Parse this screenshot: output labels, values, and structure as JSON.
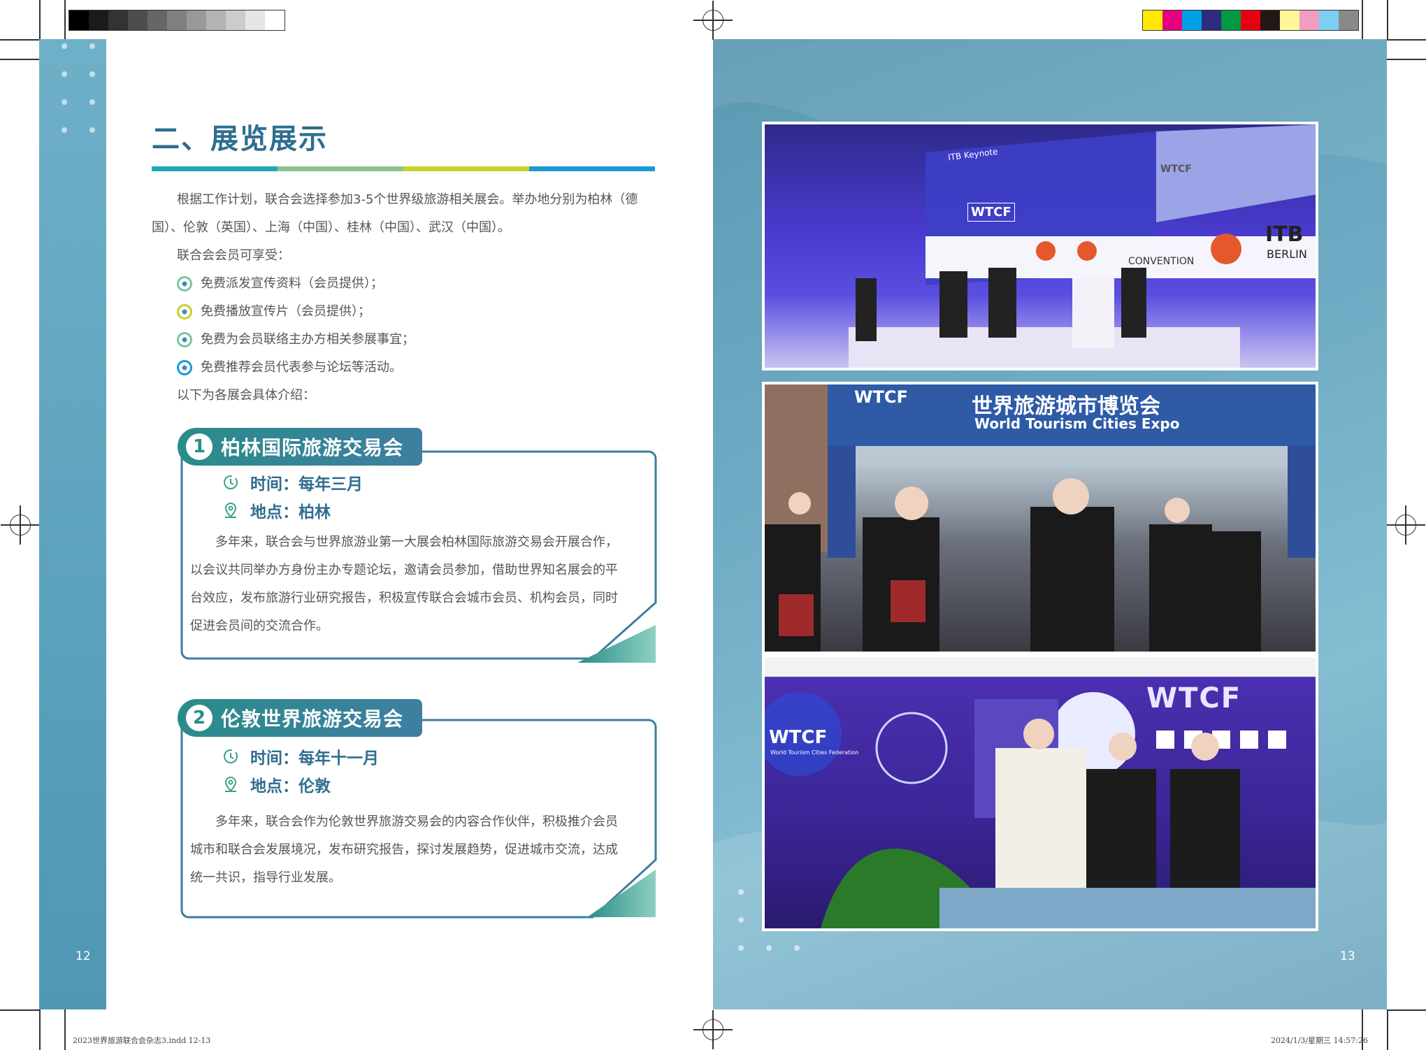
{
  "left_page": {
    "heading": "二、展览展示",
    "heading_bar_colors": [
      "#1ba8b8",
      "#8cc48c",
      "#c8d22a",
      "#1c9ad6"
    ],
    "intro_lines": [
      "根据工作计划，联合会选择参加3-5个世界级旅游相关展会。举办地分别为柏林（德",
      "国）、伦敦（英国）、上海（中国）、桂林（中国）、武汉（中国）。",
      "联合会会员可享受："
    ],
    "benefits": [
      "免费派发宣传资料（会员提供）；",
      "免费播放宣传片（会员提供）；",
      "免费为会员联络主办方相关参展事宜；",
      "免费推荐会员代表参与论坛等活动。"
    ],
    "intro_outro": "以下为各展会具体介绍：",
    "cards": [
      {
        "number": "1",
        "title": "柏林国际旅游交易会",
        "time": "时间：每年三月",
        "place": "地点：柏林",
        "lines": [
          "多年来，联合会与世界旅游业第一大展会柏林国际旅游交易会开展合作，",
          "以会议共同举办方身份主办专题论坛，邀请会员参加，借助世界知名展会的平",
          "台效应，发布旅游行业研究报告，积极宣传联合会城市会员、机构会员，同时",
          "促进会员间的交流合作。"
        ]
      },
      {
        "number": "2",
        "title": "伦敦世界旅游交易会",
        "time": "时间：每年十一月",
        "place": "地点：伦敦",
        "lines": [
          "多年来，联合会作为伦敦世界旅游交易会的内容合作伙伴，积极推介会员",
          "城市和联合会发展境况，发布研究报告，探讨发展趋势，促进城市交流，达成",
          "统一共识，指导行业发展。"
        ]
      }
    ],
    "page_number": "12",
    "file_note": "2023世界旅游联合会杂志3.indd   12-13"
  },
  "right_page": {
    "photo1": {
      "screen_text_keynote": "ITB Keynote",
      "logo_wtcf": "WTCF",
      "itb_logo": "ITB",
      "itb_city": "BERLIN",
      "convention": "CONVENTION"
    },
    "photo2": {
      "banner_cn": "世界旅游城市博览会",
      "banner_en": "World Tourism Cities Expo",
      "logo": "WTCF"
    },
    "photo3": {
      "wall_logo": "WTCF",
      "wall_logo_sub": "World Tourism Cities Federation"
    },
    "page_number": "13",
    "date_note": "2024/1/3/星期三   14:57:26"
  },
  "colors": {
    "heading": "#2e6e8f",
    "accent_teal": "#2a8c8a",
    "page_blue": "#6fabc4"
  }
}
